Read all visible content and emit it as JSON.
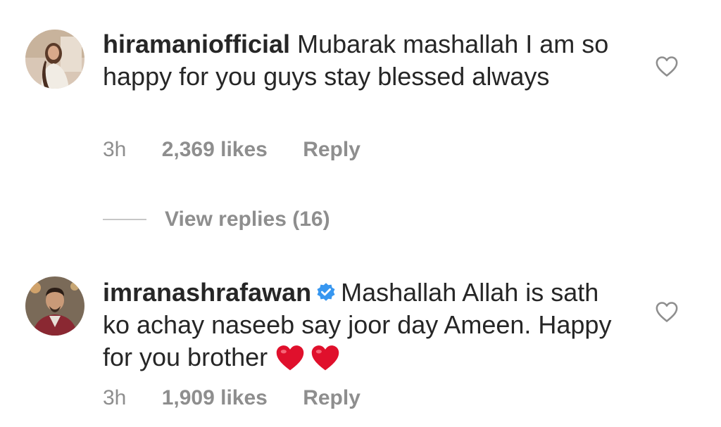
{
  "comments": [
    {
      "username": "hiramaniofficial",
      "verified": false,
      "text": "Mubarak mashallah I am so happy for you guys stay blessed always",
      "time": "3h",
      "likes": "2,369 likes",
      "reply_label": "Reply",
      "avatar_icon": "avatar-woman-photo",
      "like_icon": "heart-outline-icon"
    },
    {
      "username": "imranashrafawan",
      "verified": true,
      "text": "Mashallah Allah is sath ko achay naseeb say joor day Ameen. Happy for you brother",
      "emoji": "❤️❤️",
      "time": "3h",
      "likes": "1,909 likes",
      "reply_label": "Reply",
      "avatar_icon": "avatar-man-photo",
      "like_icon": "heart-outline-icon"
    }
  ],
  "view_replies": "View replies (16)",
  "colors": {
    "text": "#262626",
    "secondary": "#8e8e8e",
    "verified": "#3897f0",
    "heart_red": "#e0102c"
  }
}
